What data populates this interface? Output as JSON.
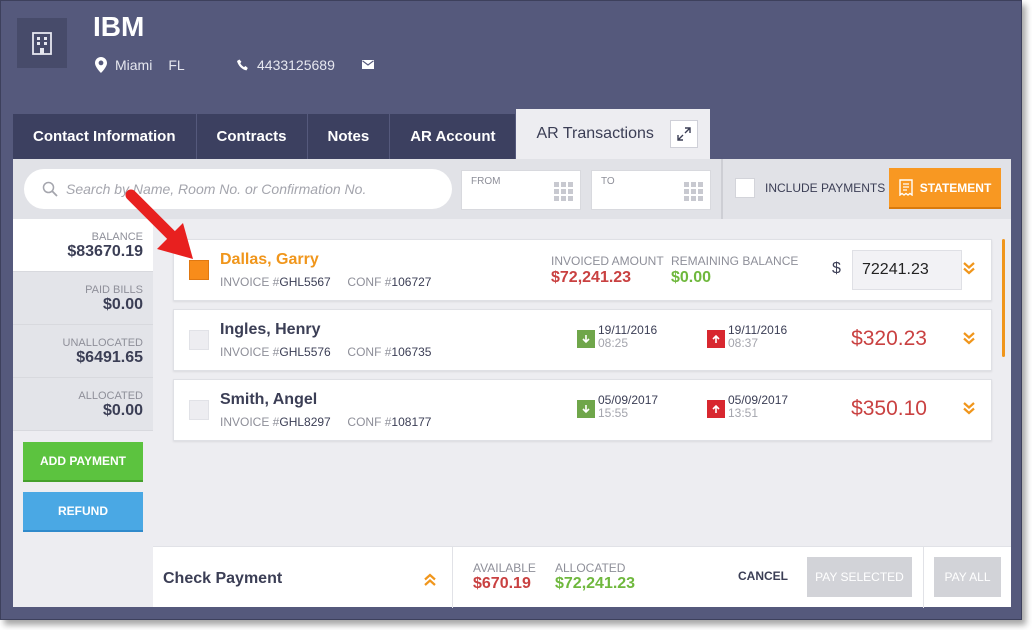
{
  "header": {
    "company": "IBM",
    "city": "Miami",
    "state": "FL",
    "phone": "4433125689"
  },
  "tabs": [
    {
      "label": "Contact Information"
    },
    {
      "label": "Contracts"
    },
    {
      "label": "Notes"
    },
    {
      "label": "AR Account"
    },
    {
      "label": "AR Transactions",
      "active": true
    }
  ],
  "toolbar": {
    "search_placeholder": "Search by Name, Room No. or Confirmation No.",
    "from_label": "FROM",
    "to_label": "TO",
    "include_payments": "INCLUDE PAYMENTS",
    "statement": "STATEMENT"
  },
  "summary": {
    "balance_label": "BALANCE",
    "balance": "$83670.19",
    "paid_label": "PAID BILLS",
    "paid": "$0.00",
    "unallocated_label": "UNALLOCATED",
    "unallocated": "$6491.65",
    "allocated_label": "ALLOCATED",
    "allocated": "$0.00",
    "add_payment": "ADD PAYMENT",
    "refund": "REFUND"
  },
  "rows": [
    {
      "name": "Dallas, Garry",
      "invoice_prefix": "INVOICE #",
      "invoice": "GHL5567",
      "conf_prefix": "CONF #",
      "conf": "106727",
      "invoiced_label": "INVOICED AMOUNT",
      "invoiced": "$72,241.23",
      "remaining_label": "REMAINING BALANCE",
      "remaining": "$0.00",
      "currency": "$",
      "pay_value": "72241.23",
      "selected": true
    },
    {
      "name": "Ingles, Henry",
      "invoice_prefix": "INVOICE #",
      "invoice": "GHL5576",
      "conf_prefix": "CONF #",
      "conf": "106735",
      "date_in": "19/11/2016",
      "time_in": "08:25",
      "date_out": "19/11/2016",
      "time_out": "08:37",
      "amount": "$320.23"
    },
    {
      "name": "Smith, Angel",
      "invoice_prefix": "INVOICE #",
      "invoice": "GHL8297",
      "conf_prefix": "CONF #",
      "conf": "108177",
      "date_in": "05/09/2017",
      "time_in": "15:55",
      "date_out": "05/09/2017",
      "time_out": "13:51",
      "amount": "$350.10"
    }
  ],
  "footer": {
    "title": "Check Payment",
    "available_label": "AVAILABLE",
    "available": "$670.19",
    "allocated_label": "ALLOCATED",
    "allocated": "$72,241.23",
    "cancel": "CANCEL",
    "pay_selected": "PAY SELECTED",
    "pay_all": "PAY ALL"
  },
  "colors": {
    "accent_orange": "#f89822",
    "header_bg": "#55597c",
    "add_green": "#5cc33f",
    "refund_blue": "#4aa8e4",
    "amount_red": "#c94141",
    "annotation_red": "#e8201f"
  },
  "icons": [
    "building-icon",
    "location-pin-icon",
    "phone-icon",
    "mail-icon",
    "expand-icon",
    "search-icon",
    "calendar-grid-icon",
    "receipt-icon",
    "chevron-double-down-icon",
    "arrow-down-icon",
    "arrow-up-icon",
    "chevron-double-up-icon",
    "annotation-arrow"
  ]
}
